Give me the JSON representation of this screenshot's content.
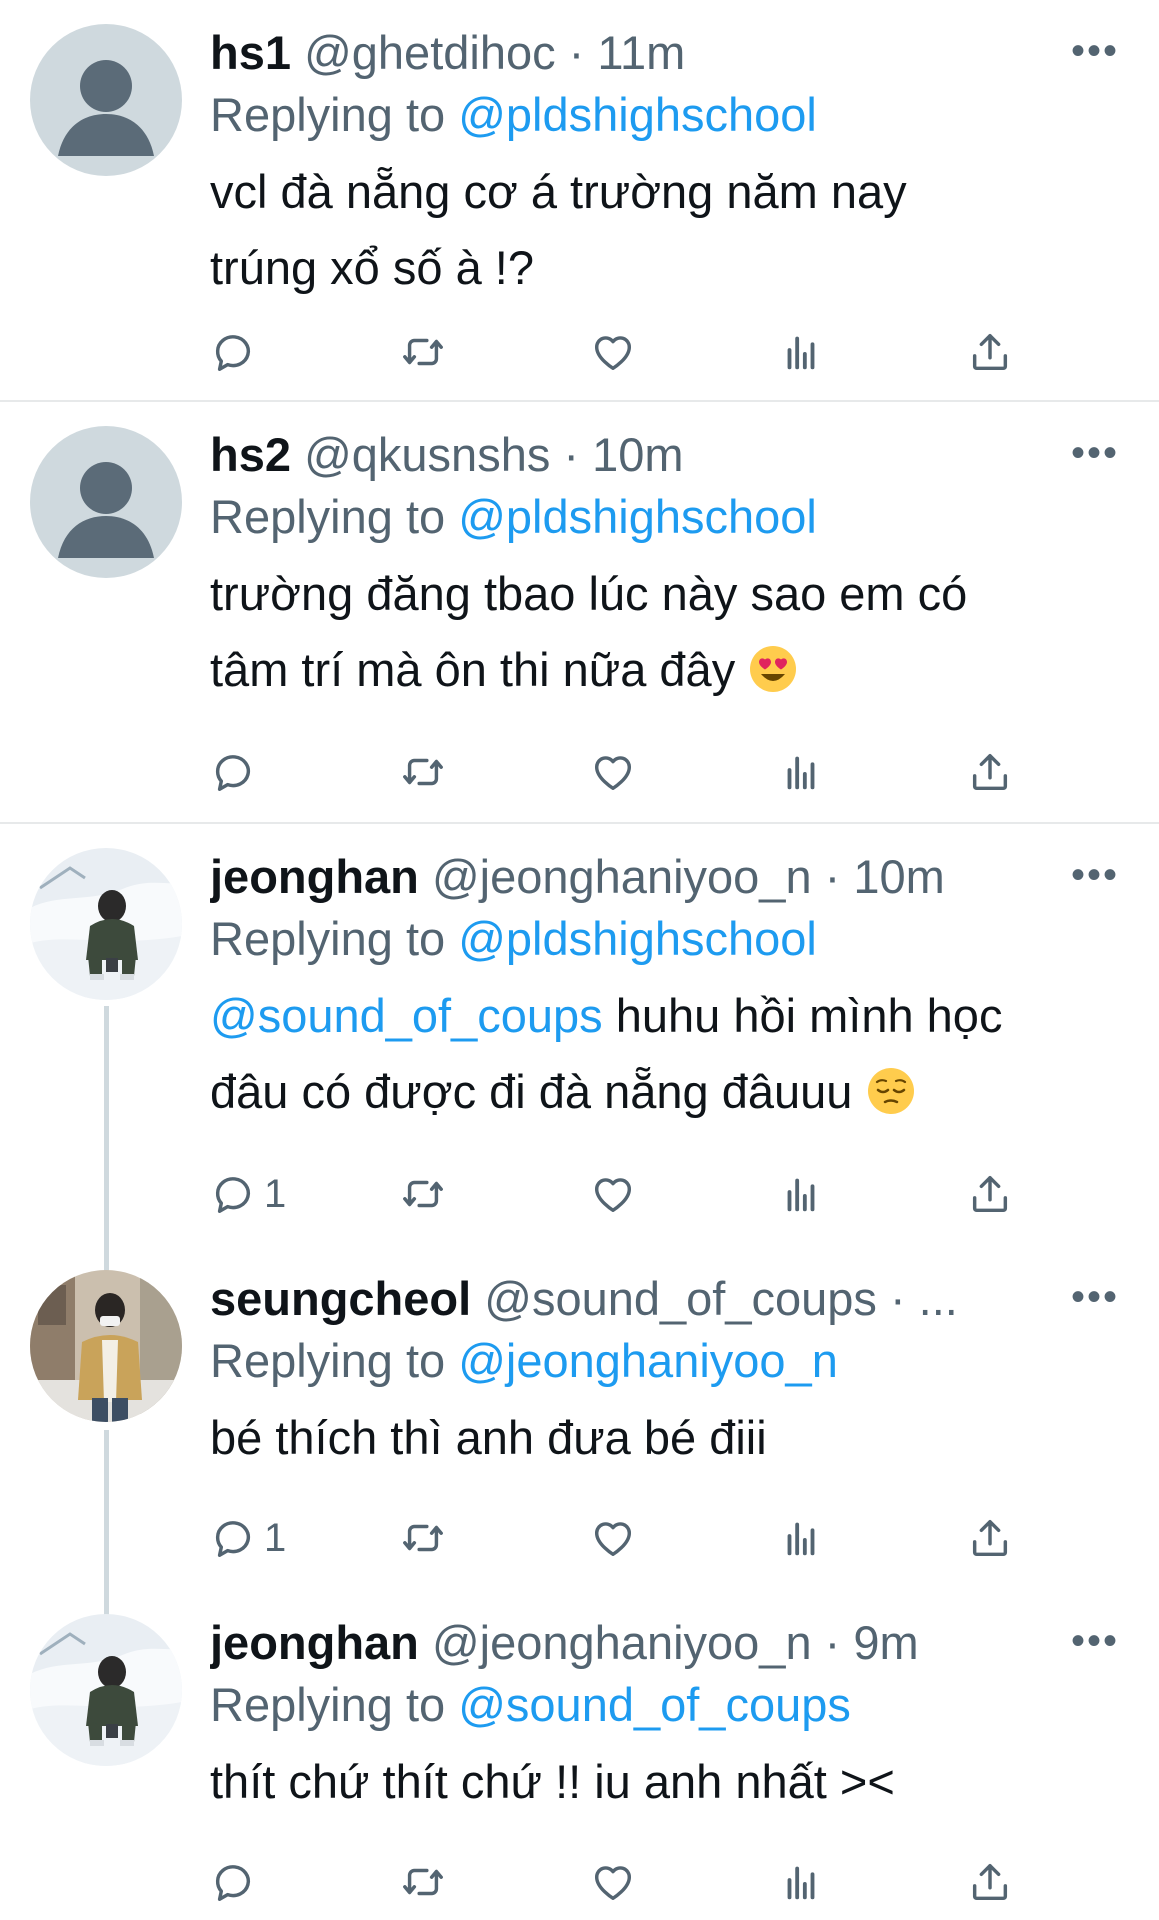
{
  "tweets": [
    {
      "name": "hs1",
      "handle": "@ghetdihoc",
      "time": "· 11m",
      "replying_prefix": "Replying to",
      "replying_to": "@pldshighschool",
      "text_line1": "vcl đà nẵng cơ á trường năm nay",
      "text_line2": "trúng xổ số à !?",
      "avatar": "default-person-avatar",
      "reply_count": ""
    },
    {
      "name": "hs2",
      "handle": "@qkusnshs",
      "time": "· 10m",
      "replying_prefix": "Replying to",
      "replying_to": "@pldshighschool",
      "text_line1": "trường đăng tbao lúc này sao em có",
      "text_line2": "tâm trí mà ôn thi nữa đây",
      "emoji": "heart-eyes",
      "avatar": "default-person-avatar",
      "reply_count": ""
    },
    {
      "name": "jeonghan",
      "handle": "@jeonghaniyoo_n",
      "time": "· 10m",
      "replying_prefix": "Replying to",
      "replying_to": "@pldshighschool",
      "text_mention": "@sound_of_coups",
      "text_line1_rest": " huhu hồi mình học",
      "text_line2": "đâu có được đi đà nẵng đâuuu",
      "emoji": "pensive-face",
      "avatar": "photo-snow",
      "reply_count": "1"
    },
    {
      "name": "seungcheol",
      "handle": "@sound_of_coups",
      "time": "· ...",
      "replying_prefix": "Replying to",
      "replying_to": "@jeonghaniyoo_n",
      "text_line1": "bé thích thì anh đưa bé điii",
      "avatar": "photo-street",
      "reply_count": "1"
    },
    {
      "name": "jeonghan",
      "handle": "@jeonghaniyoo_n",
      "time": "· 9m",
      "replying_prefix": "Replying to",
      "replying_to": "@sound_of_coups",
      "text_line1": "thít chứ thít chứ !! iu anh nhất ><",
      "avatar": "photo-snow",
      "reply_count": ""
    }
  ],
  "icons": {
    "reply": "reply-icon",
    "retweet": "retweet-icon",
    "like": "heart-icon",
    "analytics": "analytics-icon",
    "share": "share-icon",
    "more": "more-icon"
  },
  "colors": {
    "accent": "#1d9bf0",
    "secondary_text": "#536471",
    "divider": "#e7e9ea"
  }
}
